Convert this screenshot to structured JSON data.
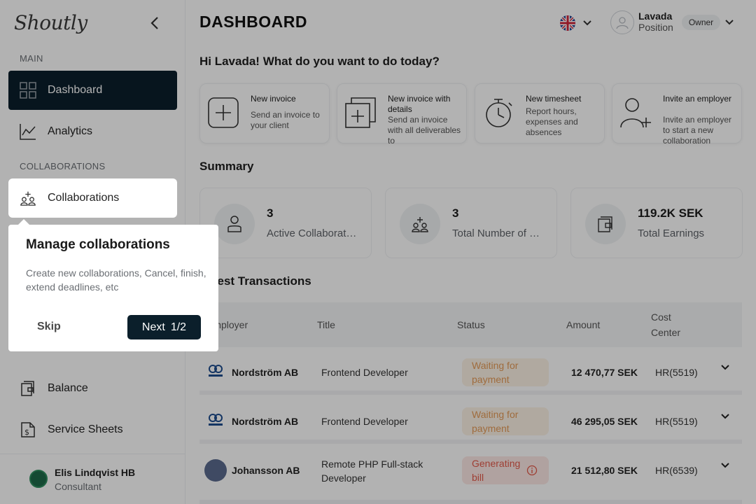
{
  "sidebar": {
    "logo": "Shoutly",
    "section_main": "MAIN",
    "section_collab": "COLLABORATIONS",
    "items": [
      {
        "label": "Dashboard",
        "icon": "grid-icon"
      },
      {
        "label": "Analytics",
        "icon": "line-chart-icon"
      },
      {
        "label": "Collaborations",
        "icon": "collaborations-icon"
      },
      {
        "label": "Balance",
        "icon": "wallet-icon"
      },
      {
        "label": "Service Sheets",
        "icon": "dollar-document-icon"
      }
    ],
    "user": {
      "name": "Elis Lindqvist HB",
      "role": "Consultant"
    }
  },
  "header": {
    "title": "DASHBOARD",
    "profile_name": "Lavada",
    "profile_position": "Position",
    "role_badge": "Owner",
    "language_flag": "uk-flag-icon"
  },
  "greeting": "Hi Lavada! What do you want to do today?",
  "actions": [
    {
      "title": "New invoice",
      "desc": "Send an invoice to your client",
      "icon": "plus-square-icon"
    },
    {
      "title": "New invoice with details",
      "desc": "Send an invoice with all deliverables to",
      "icon": "invoice-plus-icon"
    },
    {
      "title": "New timesheet",
      "desc": "Report hours, expenses and absences",
      "icon": "stopwatch-icon"
    },
    {
      "title": "Invite an employer",
      "desc": "Invite an employer to start a new collaboration",
      "icon": "user-plus-icon"
    }
  ],
  "summary": {
    "title": "Summary",
    "cards": [
      {
        "value": "3",
        "label": "Active Collaborations",
        "icon": "person-icon"
      },
      {
        "value": "3",
        "label": "Total Number of Collaborations",
        "icon": "collaborations-icon"
      },
      {
        "value": "119.2K SEK",
        "label": "Total Earnings",
        "icon": "wallet-icon"
      }
    ]
  },
  "transactions": {
    "title": "Latest Transactions",
    "columns": [
      "Employer",
      "Title",
      "Status",
      "Amount",
      "Cost Center"
    ],
    "rows": [
      {
        "employer": "Nordström AB",
        "title": "Frontend Developer",
        "status": "Waiting for payment",
        "amount": "12 470,77 SEK",
        "cost_center": "HR(5519)"
      },
      {
        "employer": "Nordström AB",
        "title": "Frontend Developer",
        "status": "Waiting for payment",
        "amount": "46 295,05 SEK",
        "cost_center": "HR(5519)"
      },
      {
        "employer": "Johansson AB",
        "title": "Remote PHP Full-stack Developer",
        "status": "Generating bill",
        "amount": "21 512,80 SEK",
        "cost_center": "HR(6539)"
      }
    ]
  },
  "tour": {
    "title": "Manage collaborations",
    "body": "Create new collaborations, Cancel, finish, extend deadlines, etc",
    "skip": "Skip",
    "next": "Next",
    "step": "1/2"
  },
  "colors": {
    "accent": "#0b1f2b",
    "waiting": "#e49b58",
    "generating": "#e35a4a"
  }
}
